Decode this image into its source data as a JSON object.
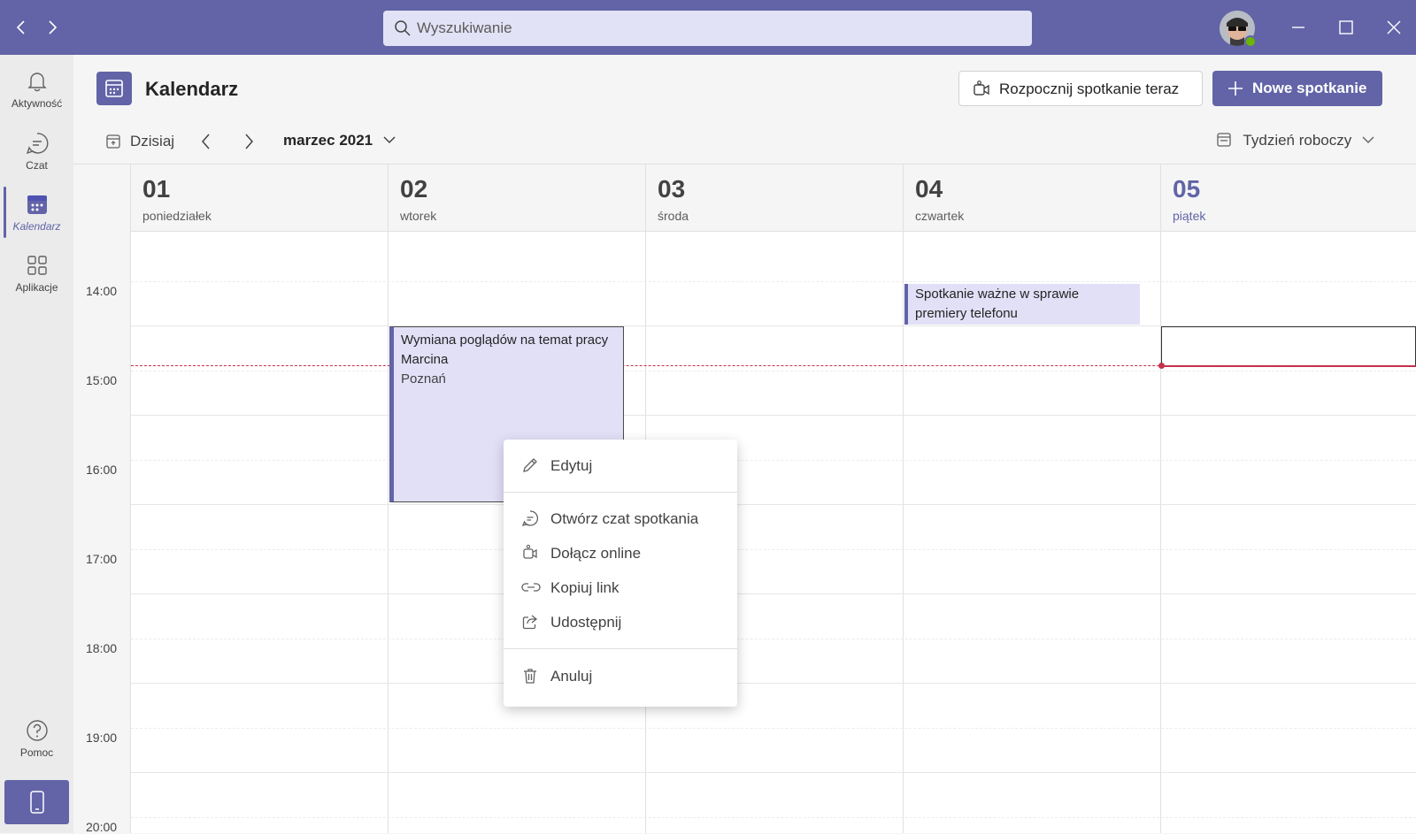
{
  "search": {
    "placeholder": "Wyszukiwanie"
  },
  "rail": {
    "items": [
      {
        "label": "Aktywność",
        "icon": "bell-icon"
      },
      {
        "label": "Czat",
        "icon": "chat-icon"
      },
      {
        "label": "Kalendarz",
        "icon": "calendar-icon",
        "active": true
      },
      {
        "label": "Aplikacje",
        "icon": "apps-icon"
      }
    ],
    "help_label": "Pomoc"
  },
  "header": {
    "title": "Kalendarz",
    "meet_now": "Rozpocznij spotkanie teraz",
    "new_meeting": "Nowe spotkanie"
  },
  "toolbar": {
    "today": "Dzisiaj",
    "month": "marzec 2021",
    "view": "Tydzień roboczy"
  },
  "days": [
    {
      "num": "01",
      "name": "poniedziałek"
    },
    {
      "num": "02",
      "name": "wtorek"
    },
    {
      "num": "03",
      "name": "środa"
    },
    {
      "num": "04",
      "name": "czwartek"
    },
    {
      "num": "05",
      "name": "piątek",
      "today": true
    }
  ],
  "times": [
    "14:00",
    "15:00",
    "16:00",
    "17:00",
    "18:00",
    "19:00",
    "20:00"
  ],
  "events": [
    {
      "title": "Wymiana poglądów na temat pracy Marcina",
      "location": "Poznań",
      "day": "02"
    },
    {
      "title": "Spotkanie ważne w sprawie premiery telefonu",
      "day": "04"
    }
  ],
  "context_menu": {
    "edit": "Edytuj",
    "open_chat": "Otwórz czat spotkania",
    "join_online": "Dołącz online",
    "copy_link": "Kopiuj link",
    "share": "Udostępnij",
    "cancel": "Anuluj"
  },
  "colors": {
    "brand": "#6264a7",
    "event_bg": "#e2e0f7",
    "now_line": "#c4314b"
  }
}
